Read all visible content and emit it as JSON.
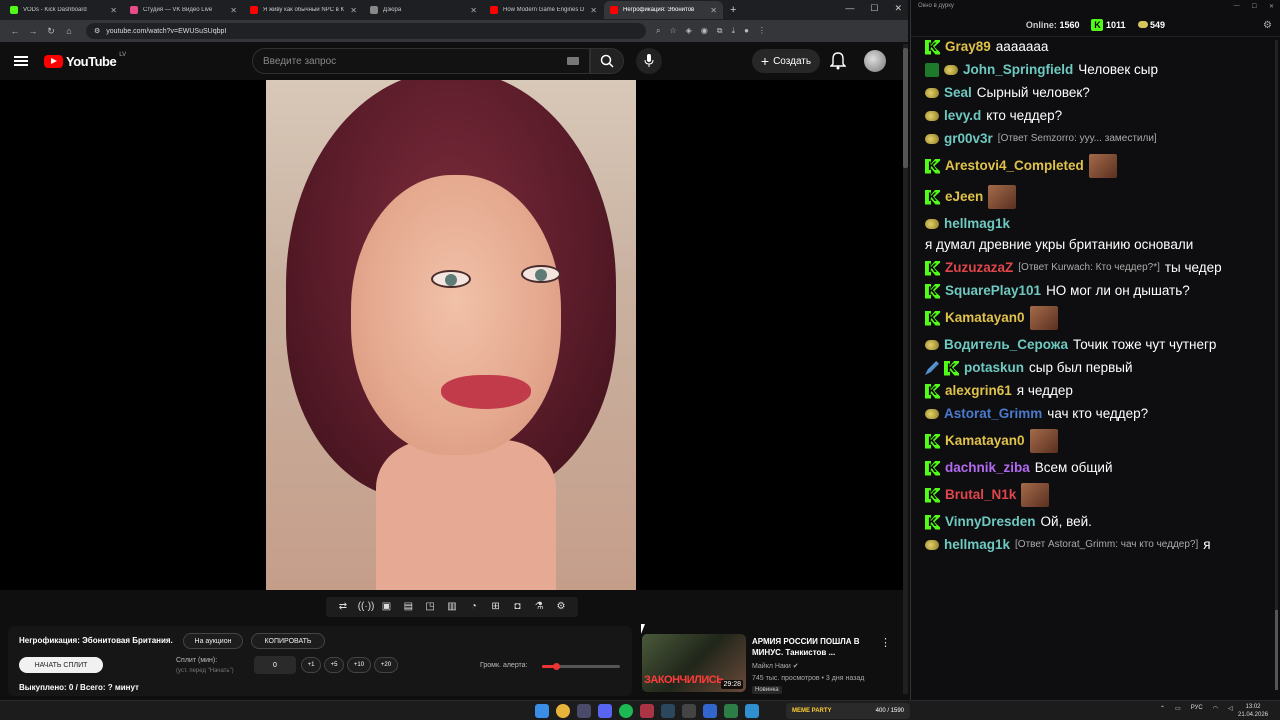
{
  "browser": {
    "tabs": [
      {
        "title": "VODs - Kick Dashboard",
        "color": "#53fc18"
      },
      {
        "title": "Студия — VK Видео Live",
        "color": "#e84a8a"
      },
      {
        "title": "Я живу как обычный NPC в К",
        "color": "#ff0000"
      },
      {
        "title": "Дзюра",
        "color": "#888888"
      },
      {
        "title": "How Modern Game Engines D",
        "color": "#ff0000"
      },
      {
        "title": "Негрофикация: Эбонитов",
        "color": "#ff0000"
      }
    ],
    "url": "youtube.com/watch?v=EWUSuSUqbpI"
  },
  "youtube": {
    "logo_text": "YouTube",
    "country": "LV",
    "search_placeholder": "Введите запрос",
    "create_label": "Создать"
  },
  "panel": {
    "title": "Негрофикация: Эбонитовая Британия.",
    "auction_label": "На аукцион",
    "copy_label": "КОПИРОВАТЬ",
    "start_split_label": "НАЧАТЬ СПЛИТ",
    "split_label": "Сплит (мин):",
    "split_sub": "(уст. перед \"Начать\")",
    "split_value": "0",
    "steps": [
      "+1",
      "+5",
      "+10",
      "+20"
    ],
    "volume_label": "Громк. алерта:",
    "volume_level": 0.18,
    "bought": "Выкуплено: 0 / Всего: ? минут"
  },
  "recommendation": {
    "thumb_text": "ЗАКОНЧИЛИСЬ",
    "duration": "29:28",
    "title": "АРМИЯ РОССИИ ПОШЛА В МИНУС. Танкистов ...",
    "channel": "Майкл Наки",
    "meta": "745 тыс. просмотров • 3 дня назад",
    "badge": "Новинка"
  },
  "chat": {
    "window_title": "Окно в дурку",
    "online_label": "Online:",
    "online_value": "1560",
    "kick_count": "1011",
    "other_count": "549",
    "messages": [
      {
        "badges": [
          "k"
        ],
        "user": "Gray89",
        "color": "#e0c24a",
        "text": "ааааааа"
      },
      {
        "badges": [
          "s",
          "p"
        ],
        "user": "John_Springfield",
        "color": "#6ec9c0",
        "text": "Человек сыр"
      },
      {
        "badges": [
          "p"
        ],
        "user": "Seal",
        "color": "#6ec9c0",
        "text": "Сырный человек?"
      },
      {
        "badges": [
          "p"
        ],
        "user": "levy.d",
        "color": "#6ec9c0",
        "text": "кто чеддер?"
      },
      {
        "badges": [
          "p"
        ],
        "user": "gr00v3r",
        "color": "#6ec9c0",
        "reply": "[Ответ Semzorro: ууу... заместили]",
        "text": ""
      },
      {
        "badges": [
          "k"
        ],
        "user": "Arestovi4_Completed",
        "color": "#e0c24a",
        "text": "",
        "emote": true
      },
      {
        "badges": [
          "k"
        ],
        "user": "eJeen",
        "color": "#e0c24a",
        "text": "",
        "emote": true
      },
      {
        "badges": [
          "p"
        ],
        "user": "hellmag1k",
        "color": "#6ec9c0",
        "text": "я думал древние укры британию основали"
      },
      {
        "badges": [
          "k"
        ],
        "user": "ZuzuzazaZ",
        "color": "#e0464a",
        "reply": "[Ответ Kurwach: Кто чеддер?*]",
        "text": "ты чедер"
      },
      {
        "badges": [
          "k"
        ],
        "user": "SquarePlay101",
        "color": "#6ec9c0",
        "text": "НО мог ли он дышать?"
      },
      {
        "badges": [
          "k"
        ],
        "user": "Kamatayan0",
        "color": "#e0c24a",
        "text": "",
        "emote": true
      },
      {
        "badges": [
          "p"
        ],
        "user": "Водитель_Серожа",
        "color": "#6ec9c0",
        "text": "Точик тоже чут чутнегр"
      },
      {
        "badges": [
          "sw",
          "k"
        ],
        "user": "potaskun",
        "color": "#6ec9c0",
        "text": "сыр был первый"
      },
      {
        "badges": [
          "k"
        ],
        "user": "alexgrin61",
        "color": "#e0c24a",
        "text": "я чеддер"
      },
      {
        "badges": [
          "p"
        ],
        "user": "Astorat_Grimm",
        "color": "#4a7acc",
        "text": "чач кто чеддер?"
      },
      {
        "badges": [
          "k"
        ],
        "user": "Kamatayan0",
        "color": "#e0c24a",
        "text": "",
        "emote": true
      },
      {
        "badges": [
          "k"
        ],
        "user": "dachnik_ziba",
        "color": "#b36af0",
        "text": "Всем общий"
      },
      {
        "badges": [
          "k"
        ],
        "user": "Brutal_N1k",
        "color": "#e0464a",
        "text": "",
        "emote": true
      },
      {
        "badges": [
          "k"
        ],
        "user": "VinnyDresden",
        "color": "#6ec9c0",
        "text": "Ой, вей."
      },
      {
        "badges": [
          "p"
        ],
        "user": "hellmag1k",
        "color": "#6ec9c0",
        "reply": "[Ответ Astorat_Grimm: чач кто чеддер?]",
        "text": "я"
      }
    ]
  },
  "taskbar": {
    "meme_label": "MEME PARTY",
    "meme_count": "400 / 1590",
    "lang": "РУС",
    "time": "13:02",
    "date": "21.04.2026"
  }
}
